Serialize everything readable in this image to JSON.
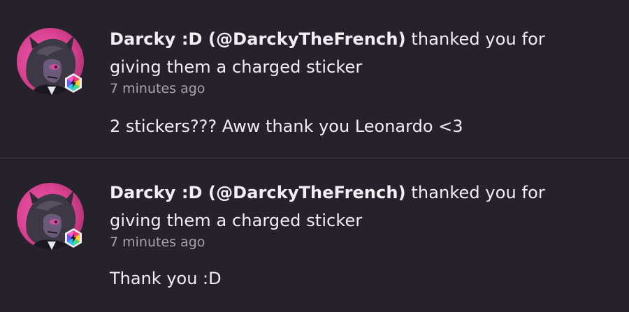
{
  "notifications": [
    {
      "user_display": "Darcky :D (@DarckyTheFrench)",
      "action_text": " thanked you for giving them a charged sticker",
      "timestamp": "7 minutes ago",
      "message": "2 stickers??? Aww thank you Leonardo <3",
      "avatar_icon": "user-avatar-icon",
      "badge_icon": "charged-badge-icon"
    },
    {
      "user_display": "Darcky :D (@DarckyTheFrench)",
      "action_text": " thanked you for giving them a charged sticker",
      "timestamp": "7 minutes ago",
      "message": "Thank you :D",
      "avatar_icon": "user-avatar-icon",
      "badge_icon": "charged-badge-icon"
    }
  ],
  "colors": {
    "background": "#25222b",
    "divider": "#3b3842",
    "text_primary": "#f1eff4",
    "text_secondary": "#a6a3ad",
    "avatar_accent": "#e0449a"
  }
}
